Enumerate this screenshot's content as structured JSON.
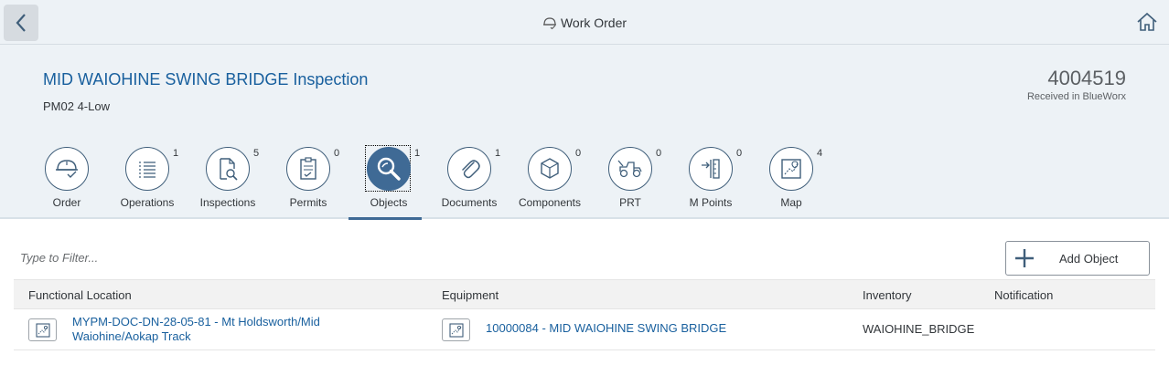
{
  "shell": {
    "title": "Work Order",
    "back_icon": "back-chevron-icon",
    "home_icon": "home-icon"
  },
  "header": {
    "title": "MID WAIOHINE SWING BRIDGE Inspection",
    "subtitle": "PM02 4-Low",
    "number": "4004519",
    "number_unit": "Received in BlueWorx"
  },
  "tabs": [
    {
      "label": "Order",
      "count": "",
      "icon": "helmet-check-icon"
    },
    {
      "label": "Operations",
      "count": "1",
      "icon": "list-icon"
    },
    {
      "label": "Inspections",
      "count": "5",
      "icon": "document-search-icon"
    },
    {
      "label": "Permits",
      "count": "0",
      "icon": "checklist-icon"
    },
    {
      "label": "Objects",
      "count": "1",
      "icon": "magnifier-icon",
      "selected": true
    },
    {
      "label": "Documents",
      "count": "1",
      "icon": "paperclip-icon"
    },
    {
      "label": "Components",
      "count": "0",
      "icon": "box-icon"
    },
    {
      "label": "PRT",
      "count": "0",
      "icon": "tractor-icon"
    },
    {
      "label": "M Points",
      "count": "0",
      "icon": "measure-icon"
    },
    {
      "label": "Map",
      "count": "4",
      "icon": "map-icon"
    }
  ],
  "filter": {
    "placeholder": "Type to Filter..."
  },
  "add_button": {
    "label": "Add Object"
  },
  "table": {
    "columns": [
      "Functional Location",
      "Equipment",
      "Inventory",
      "Notification"
    ],
    "rows": [
      {
        "functional_location_line1": "MYPM-DOC-DN-28-05-81 - Mt Holdsworth/Mid",
        "functional_location_line2": "Waiohine/Aokap Track",
        "equipment": "10000084 - MID WAIOHINE SWING BRIDGE",
        "inventory": "WAIOHINE_BRIDGE",
        "notification": ""
      }
    ]
  },
  "colors": {
    "header_bg": "#edf2f6",
    "selected_tab": "#3f6a95",
    "link": "#19609e"
  }
}
